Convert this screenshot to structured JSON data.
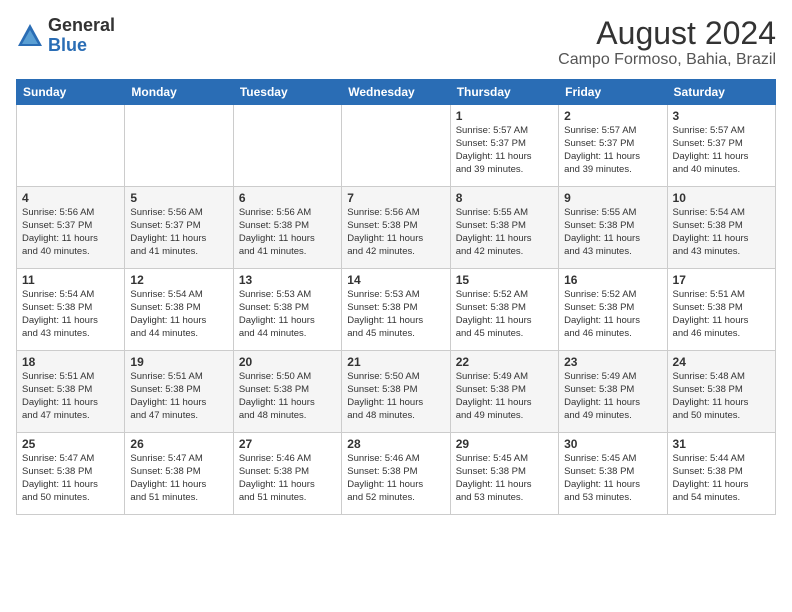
{
  "header": {
    "logo_line1": "General",
    "logo_line2": "Blue",
    "month": "August 2024",
    "location": "Campo Formoso, Bahia, Brazil"
  },
  "weekdays": [
    "Sunday",
    "Monday",
    "Tuesday",
    "Wednesday",
    "Thursday",
    "Friday",
    "Saturday"
  ],
  "weeks": [
    [
      {
        "day": "",
        "info": ""
      },
      {
        "day": "",
        "info": ""
      },
      {
        "day": "",
        "info": ""
      },
      {
        "day": "",
        "info": ""
      },
      {
        "day": "1",
        "info": "Sunrise: 5:57 AM\nSunset: 5:37 PM\nDaylight: 11 hours\nand 39 minutes."
      },
      {
        "day": "2",
        "info": "Sunrise: 5:57 AM\nSunset: 5:37 PM\nDaylight: 11 hours\nand 39 minutes."
      },
      {
        "day": "3",
        "info": "Sunrise: 5:57 AM\nSunset: 5:37 PM\nDaylight: 11 hours\nand 40 minutes."
      }
    ],
    [
      {
        "day": "4",
        "info": "Sunrise: 5:56 AM\nSunset: 5:37 PM\nDaylight: 11 hours\nand 40 minutes."
      },
      {
        "day": "5",
        "info": "Sunrise: 5:56 AM\nSunset: 5:37 PM\nDaylight: 11 hours\nand 41 minutes."
      },
      {
        "day": "6",
        "info": "Sunrise: 5:56 AM\nSunset: 5:38 PM\nDaylight: 11 hours\nand 41 minutes."
      },
      {
        "day": "7",
        "info": "Sunrise: 5:56 AM\nSunset: 5:38 PM\nDaylight: 11 hours\nand 42 minutes."
      },
      {
        "day": "8",
        "info": "Sunrise: 5:55 AM\nSunset: 5:38 PM\nDaylight: 11 hours\nand 42 minutes."
      },
      {
        "day": "9",
        "info": "Sunrise: 5:55 AM\nSunset: 5:38 PM\nDaylight: 11 hours\nand 43 minutes."
      },
      {
        "day": "10",
        "info": "Sunrise: 5:54 AM\nSunset: 5:38 PM\nDaylight: 11 hours\nand 43 minutes."
      }
    ],
    [
      {
        "day": "11",
        "info": "Sunrise: 5:54 AM\nSunset: 5:38 PM\nDaylight: 11 hours\nand 43 minutes."
      },
      {
        "day": "12",
        "info": "Sunrise: 5:54 AM\nSunset: 5:38 PM\nDaylight: 11 hours\nand 44 minutes."
      },
      {
        "day": "13",
        "info": "Sunrise: 5:53 AM\nSunset: 5:38 PM\nDaylight: 11 hours\nand 44 minutes."
      },
      {
        "day": "14",
        "info": "Sunrise: 5:53 AM\nSunset: 5:38 PM\nDaylight: 11 hours\nand 45 minutes."
      },
      {
        "day": "15",
        "info": "Sunrise: 5:52 AM\nSunset: 5:38 PM\nDaylight: 11 hours\nand 45 minutes."
      },
      {
        "day": "16",
        "info": "Sunrise: 5:52 AM\nSunset: 5:38 PM\nDaylight: 11 hours\nand 46 minutes."
      },
      {
        "day": "17",
        "info": "Sunrise: 5:51 AM\nSunset: 5:38 PM\nDaylight: 11 hours\nand 46 minutes."
      }
    ],
    [
      {
        "day": "18",
        "info": "Sunrise: 5:51 AM\nSunset: 5:38 PM\nDaylight: 11 hours\nand 47 minutes."
      },
      {
        "day": "19",
        "info": "Sunrise: 5:51 AM\nSunset: 5:38 PM\nDaylight: 11 hours\nand 47 minutes."
      },
      {
        "day": "20",
        "info": "Sunrise: 5:50 AM\nSunset: 5:38 PM\nDaylight: 11 hours\nand 48 minutes."
      },
      {
        "day": "21",
        "info": "Sunrise: 5:50 AM\nSunset: 5:38 PM\nDaylight: 11 hours\nand 48 minutes."
      },
      {
        "day": "22",
        "info": "Sunrise: 5:49 AM\nSunset: 5:38 PM\nDaylight: 11 hours\nand 49 minutes."
      },
      {
        "day": "23",
        "info": "Sunrise: 5:49 AM\nSunset: 5:38 PM\nDaylight: 11 hours\nand 49 minutes."
      },
      {
        "day": "24",
        "info": "Sunrise: 5:48 AM\nSunset: 5:38 PM\nDaylight: 11 hours\nand 50 minutes."
      }
    ],
    [
      {
        "day": "25",
        "info": "Sunrise: 5:47 AM\nSunset: 5:38 PM\nDaylight: 11 hours\nand 50 minutes."
      },
      {
        "day": "26",
        "info": "Sunrise: 5:47 AM\nSunset: 5:38 PM\nDaylight: 11 hours\nand 51 minutes."
      },
      {
        "day": "27",
        "info": "Sunrise: 5:46 AM\nSunset: 5:38 PM\nDaylight: 11 hours\nand 51 minutes."
      },
      {
        "day": "28",
        "info": "Sunrise: 5:46 AM\nSunset: 5:38 PM\nDaylight: 11 hours\nand 52 minutes."
      },
      {
        "day": "29",
        "info": "Sunrise: 5:45 AM\nSunset: 5:38 PM\nDaylight: 11 hours\nand 53 minutes."
      },
      {
        "day": "30",
        "info": "Sunrise: 5:45 AM\nSunset: 5:38 PM\nDaylight: 11 hours\nand 53 minutes."
      },
      {
        "day": "31",
        "info": "Sunrise: 5:44 AM\nSunset: 5:38 PM\nDaylight: 11 hours\nand 54 minutes."
      }
    ]
  ]
}
